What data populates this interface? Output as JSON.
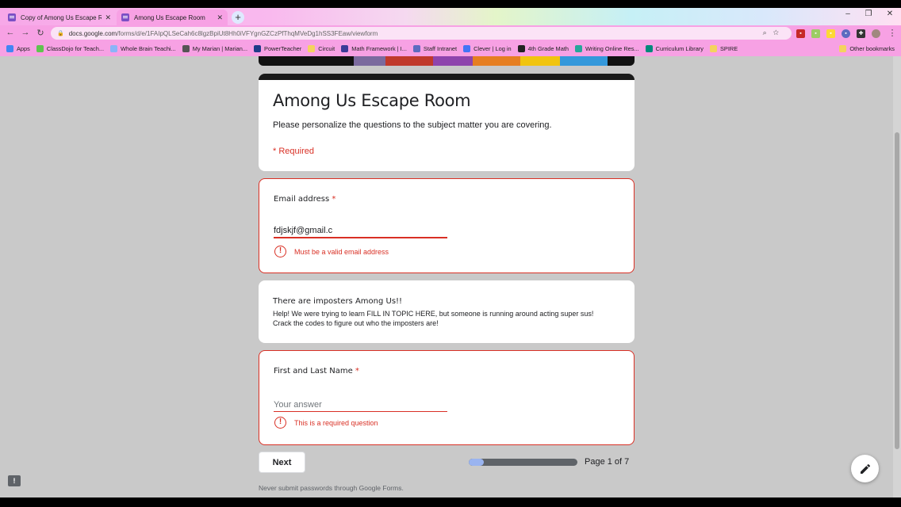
{
  "browser": {
    "tabs": [
      {
        "label": "Copy of Among Us Escape Room",
        "active": false
      },
      {
        "label": "Among Us Escape Room",
        "active": true
      }
    ],
    "new_tab_label": "+",
    "window_controls": {
      "minimize": "–",
      "restore": "❐",
      "close": "✕"
    },
    "url_host": "docs.google.com",
    "url_path": "/forms/d/e/1FAIpQLSeCah6c8lgzBpiUt8Hh0iVFYgnGZCzPfThqMVeDg1hSS3FEaw/viewform",
    "bookmarks": [
      {
        "label": "Apps",
        "color": "#4285f4"
      },
      {
        "label": "ClassDojo for Teach...",
        "color": "#60c34f"
      },
      {
        "label": "Whole Brain Teachi...",
        "color": "#8ab4f8"
      },
      {
        "label": "My Marian | Marian...",
        "color": "#555555"
      },
      {
        "label": "PowerTeacher",
        "color": "#1f3c88"
      },
      {
        "label": "Circuit",
        "color": "#f4d35e"
      },
      {
        "label": "Math Framework | I...",
        "color": "#3b3b98"
      },
      {
        "label": "Staff Intranet",
        "color": "#5c6bc0"
      },
      {
        "label": "Clever | Log in",
        "color": "#4274f6"
      },
      {
        "label": "4th Grade Math",
        "color": "#222222"
      },
      {
        "label": "Writing Online Res...",
        "color": "#26a69a"
      },
      {
        "label": "Curriculum Library",
        "color": "#00897b"
      },
      {
        "label": "SPIRE",
        "color": "#f4d35e"
      }
    ],
    "other_bookmarks": "Other bookmarks"
  },
  "form": {
    "title": "Among Us Escape Room",
    "description": "Please personalize the questions to the subject matter you are covering.",
    "required_note": "* Required",
    "email": {
      "label": "Email address",
      "required_mark": "*",
      "value": "fdjskjf@gmail.c",
      "error": "Must be a valid email address"
    },
    "info": {
      "title": "There are imposters Among Us!!",
      "body_line1": "Help! We were trying to learn FILL IN TOPIC HERE, but someone is running around acting super sus!",
      "body_line2": "Crack the codes to figure out who the imposters are!"
    },
    "name": {
      "label": "First and Last Name",
      "required_mark": "*",
      "value": "",
      "placeholder": "Your answer",
      "error": "This is a required question"
    },
    "next_label": "Next",
    "progress": {
      "current": 1,
      "total": 7,
      "fraction": 0.14,
      "text": "Page 1 of 7"
    },
    "footer": "Never submit passwords through Google Forms."
  },
  "icons": {
    "error": "!",
    "feedback": "!",
    "edit": "pencil-icon"
  },
  "colors": {
    "error": "#d93025",
    "browser_chrome": "#f7a1e4",
    "progress_fill": "#9ab4f0",
    "progress_track": "#5f6368"
  }
}
